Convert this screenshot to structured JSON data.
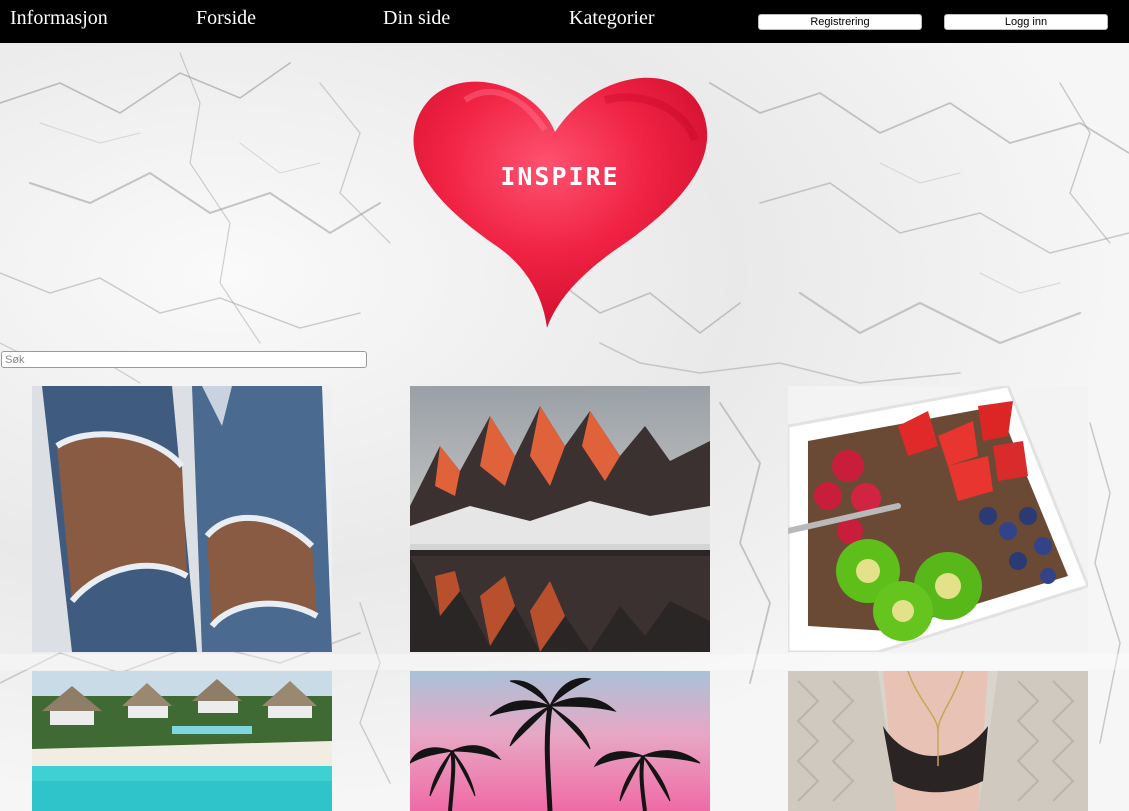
{
  "nav": {
    "links": [
      "Informasjon",
      "Forside",
      "Din side",
      "Kategorier"
    ],
    "register_label": "Registrering",
    "login_label": "Logg inn"
  },
  "hero": {
    "heart_text": "INSPIRE",
    "heart_color": "#e8102c"
  },
  "search": {
    "placeholder": "Søk"
  },
  "gallery": {
    "items": [
      {
        "name": "ripped-jeans-photo",
        "subject": "ripped jeans"
      },
      {
        "name": "mountain-lake-photo",
        "subject": "mountains reflected in lake"
      },
      {
        "name": "fruit-bowl-photo",
        "subject": "bowl of berries and kiwi"
      },
      {
        "name": "beach-resort-photo",
        "subject": "tropical beach resort"
      },
      {
        "name": "palm-sunset-photo",
        "subject": "palm trees at pink sunset"
      },
      {
        "name": "knit-cardigan-photo",
        "subject": "knit cardigan and lace top"
      }
    ]
  },
  "colors": {
    "nav_bg": "#000000",
    "accent_red": "#e8102c"
  }
}
